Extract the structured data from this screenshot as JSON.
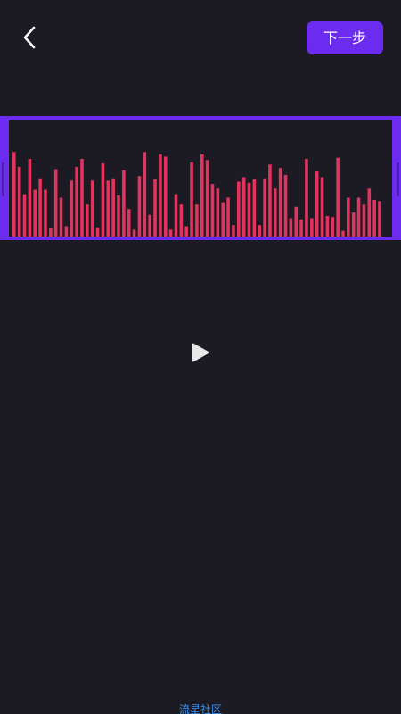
{
  "header": {
    "next_label": "下一步"
  },
  "colors": {
    "background": "#1c1b23",
    "accent": "#6c2cf0",
    "bar": "#e0335e",
    "icon": "#ffffff",
    "play_icon": "#e8e8e8",
    "watermark": "#3a8ff0"
  },
  "icons": {
    "back": "chevron-left-icon",
    "play": "play-icon"
  },
  "waveform": {
    "levels": [
      0.74,
      0.61,
      0.37,
      0.68,
      0.41,
      0.51,
      0.41,
      0.07,
      0.59,
      0.34,
      0.09,
      0.49,
      0.61,
      0.68,
      0.28,
      0.49,
      0.08,
      0.64,
      0.49,
      0.51,
      0.36,
      0.58,
      0.24,
      0.06,
      0.53,
      0.74,
      0.19,
      0.5,
      0.72,
      0.7,
      0.06,
      0.37,
      0.28,
      0.09,
      0.65,
      0.28,
      0.72,
      0.67,
      0.46,
      0.42,
      0.3,
      0.34,
      0.1,
      0.48,
      0.52,
      0.47,
      0.5,
      0.1,
      0.51,
      0.63,
      0.42,
      0.6,
      0.54,
      0.16,
      0.26,
      0.15,
      0.68,
      0.16,
      0.57,
      0.52,
      0.18,
      0.17,
      0.69,
      0.05,
      0.34,
      0.21,
      0.34,
      0.28,
      0.42,
      0.32,
      0.31
    ]
  },
  "watermark": {
    "text": "流星社区"
  }
}
